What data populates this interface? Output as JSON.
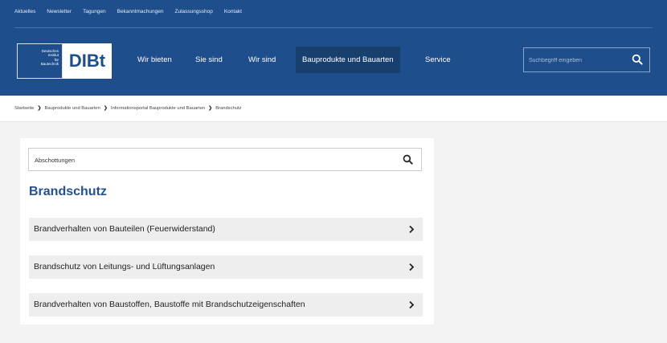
{
  "topnav": [
    "Aktuelles",
    "Newsletter",
    "Tagungen",
    "Bekanntmachungen",
    "Zulassungsshop",
    "Kontakt"
  ],
  "logo": {
    "small_text": "Deutsches\nInstitut\nfür\nBautechnik",
    "mark": "DIBt"
  },
  "mainnav": [
    "Wir bieten",
    "Sie sind",
    "Wir sind",
    "Bauprodukte und Bauarten",
    "Service"
  ],
  "header_search": {
    "placeholder": "Suchbegriff eingeben"
  },
  "breadcrumb": [
    "Startseite",
    "Bauprodukte und Bauarten",
    "Informationsportal Bauprodukte und Bauarten",
    "Brandschutz"
  ],
  "breadcrumb_separator": "❯",
  "main": {
    "search_value": "Abschottungen",
    "title": "Brandschutz",
    "items": [
      "Brandverhalten von Bauteilen (Feuerwiderstand)",
      "Brandschutz von Leitungs- und Lüftungsanlagen",
      "Brandverhalten von Baustoffen, Baustoffe mit Brandschutzeigenschaften"
    ]
  },
  "colors": {
    "brand": "#1f4e8c",
    "nav_active": "#18406f",
    "title": "#24508f"
  }
}
